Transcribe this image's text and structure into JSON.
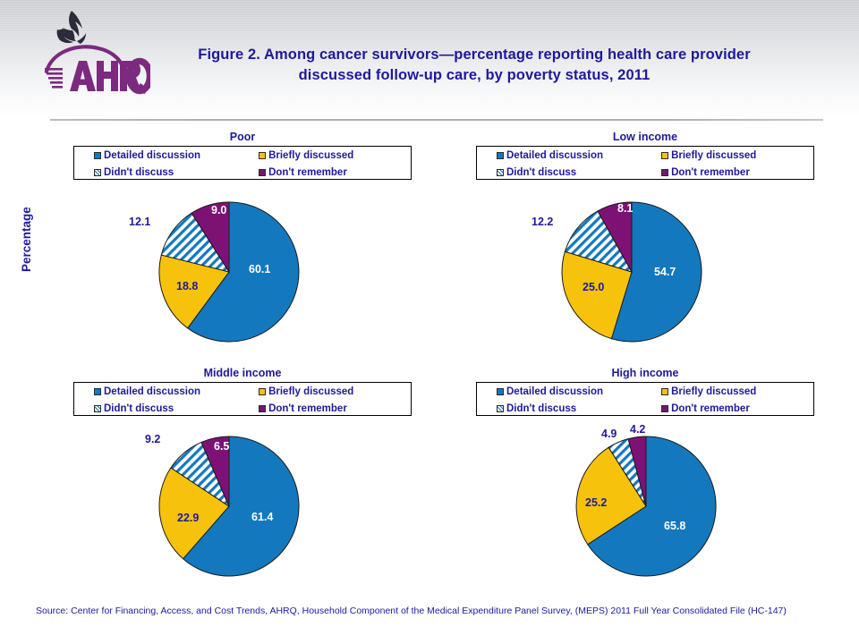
{
  "header": {
    "logo_alt": "AHRQ - Agency for Healthcare Research and Quality",
    "title": "Figure 2. Among cancer survivors—percentage reporting health care provider discussed follow-up care, by poverty status, 2011"
  },
  "axis": {
    "y_label": "Percentage"
  },
  "legend_labels": {
    "detailed": "Detailed discussion",
    "briefly": "Briefly discussed",
    "didnt": "Didn't discuss",
    "dont_remember": "Don't remember"
  },
  "colors": {
    "detailed": "#1478be",
    "briefly": "#f7c20b",
    "didnt": "#1478be",
    "dont_remember": "#7d1274",
    "text_blue": "#1f199c",
    "label_white": "#ffffff"
  },
  "source": "Source: Center for Financing, Access, and Cost Trends, AHRQ, Household Component of the Medical Expenditure Panel Survey, (MEPS) 2011 Full Year Consolidated File (HC-147)",
  "chart_data": [
    {
      "type": "pie",
      "title": "Poor",
      "categories": [
        "Detailed discussion",
        "Briefly discussed",
        "Didn't discuss",
        "Don't remember"
      ],
      "values": [
        60.1,
        18.8,
        12.1,
        9.0
      ],
      "labels": [
        "60.1",
        "18.8",
        "12.1",
        "9.0"
      ],
      "unit": "percent",
      "legend_position": "top"
    },
    {
      "type": "pie",
      "title": "Low income",
      "categories": [
        "Detailed discussion",
        "Briefly discussed",
        "Didn't discuss",
        "Don't remember"
      ],
      "values": [
        54.7,
        25.0,
        12.2,
        8.1
      ],
      "labels": [
        "54.7",
        "25.0",
        "12.2",
        "8.1"
      ],
      "unit": "percent",
      "legend_position": "top"
    },
    {
      "type": "pie",
      "title": "Middle income",
      "categories": [
        "Detailed discussion",
        "Briefly discussed",
        "Didn't discuss",
        "Don't remember"
      ],
      "values": [
        61.4,
        22.9,
        9.2,
        6.5
      ],
      "labels": [
        "61.4",
        "22.9",
        "9.2",
        "6.5"
      ],
      "unit": "percent",
      "legend_position": "top"
    },
    {
      "type": "pie",
      "title": "High income",
      "categories": [
        "Detailed discussion",
        "Briefly discussed",
        "Didn't discuss",
        "Don't remember"
      ],
      "values": [
        65.8,
        25.2,
        4.9,
        4.2
      ],
      "labels": [
        "65.8",
        "25.2",
        "4.9",
        "4.2"
      ],
      "unit": "percent",
      "legend_position": "top"
    }
  ]
}
